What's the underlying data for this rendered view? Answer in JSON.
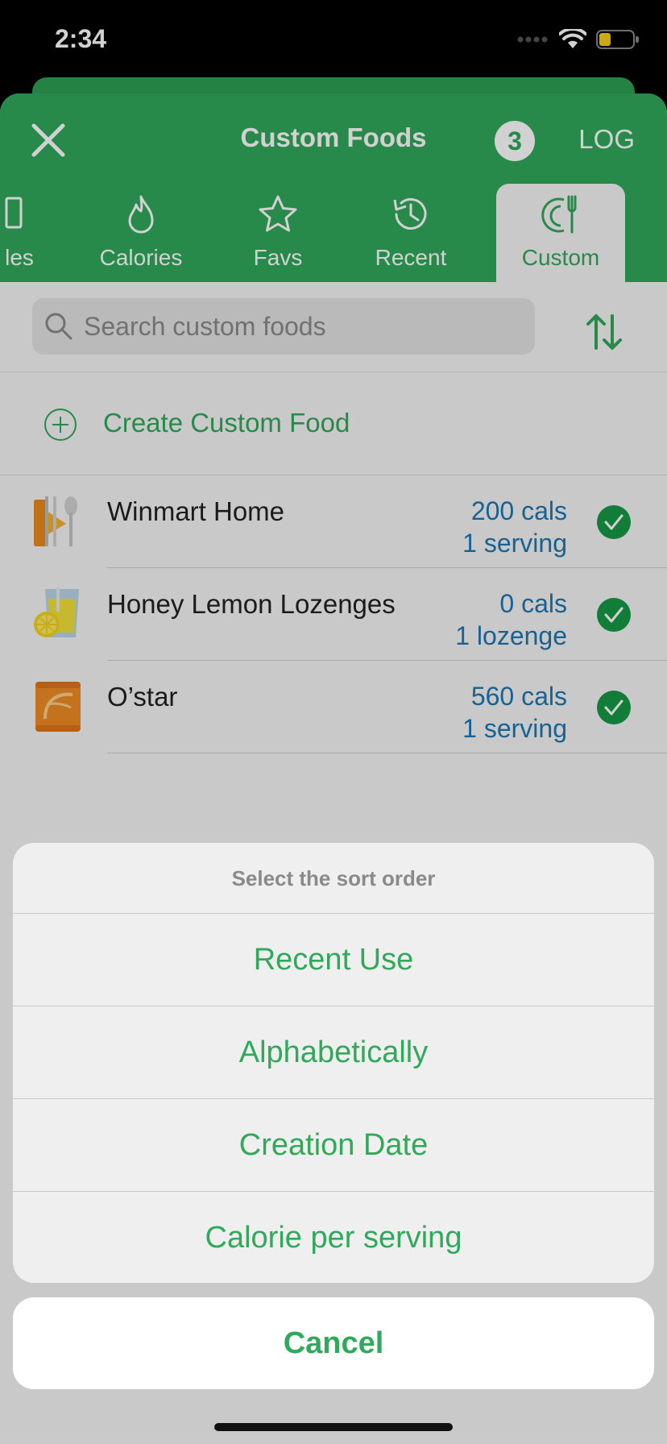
{
  "status_bar": {
    "time": "2:34"
  },
  "header": {
    "title": "Custom Foods",
    "count": "3",
    "log_label": "LOG",
    "close_icon": "close-icon"
  },
  "tabs": [
    {
      "label": "les",
      "icon": "meals-icon"
    },
    {
      "label": "Calories",
      "icon": "flame-icon"
    },
    {
      "label": "Favs",
      "icon": "star-icon"
    },
    {
      "label": "Recent",
      "icon": "history-icon"
    },
    {
      "label": "Custom",
      "icon": "fork-plate-icon",
      "active": true
    }
  ],
  "search": {
    "placeholder": "Search custom foods",
    "value": ""
  },
  "create_custom_food": "Create Custom Food",
  "foods": [
    {
      "name": "Winmart Home",
      "cals": "200 cals",
      "serving": "1 serving",
      "icon": "utensils-icon",
      "logged": true
    },
    {
      "name": "Honey Lemon Lozenges",
      "cals": "0 cals",
      "serving": "1 lozenge",
      "icon": "lemon-drink-icon",
      "logged": true
    },
    {
      "name": "O’star",
      "cals": "560 cals",
      "serving": "1 serving",
      "icon": "snack-bag-icon",
      "logged": true
    }
  ],
  "sort_sheet": {
    "title": "Select the sort order",
    "options": [
      "Recent Use",
      "Alphabetically",
      "Creation Date",
      "Calorie per serving"
    ],
    "cancel_label": "Cancel"
  },
  "colors": {
    "brand_green": "#31a95b",
    "link_blue": "#1e78b4"
  }
}
